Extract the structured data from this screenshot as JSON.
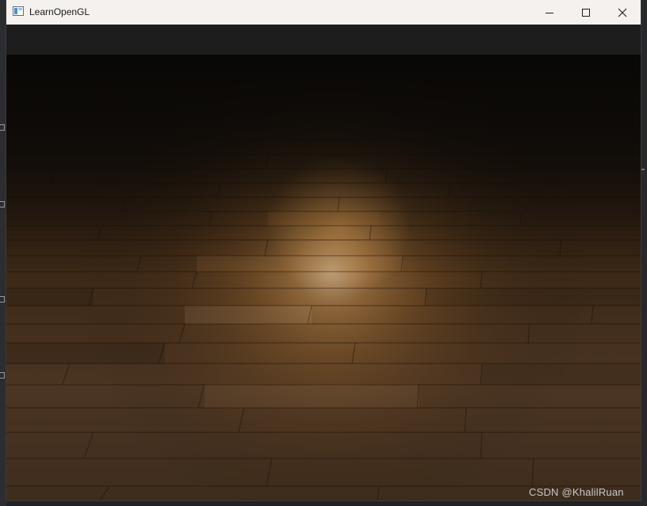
{
  "window": {
    "title": "LearnOpenGL",
    "icon": "opengl-app-icon"
  },
  "controls": {
    "minimize_icon": "minimize-icon",
    "maximize_icon": "maximize-icon",
    "close_icon": "close-icon"
  },
  "scene": {
    "description_colors": {
      "wood_light": "#a57a4a",
      "wood_dark": "#3a2414",
      "spotlight": "#ffc878"
    }
  },
  "watermark": {
    "text": "CSDN @KhalilRuan"
  }
}
